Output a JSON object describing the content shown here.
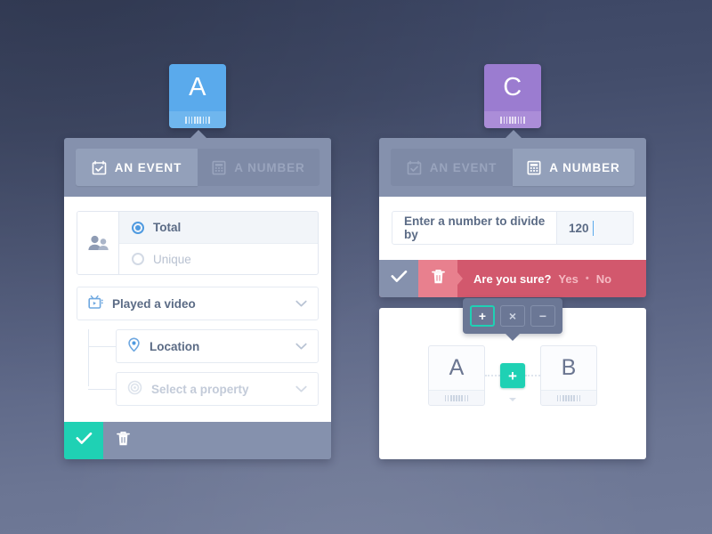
{
  "tiles": [
    {
      "letter": "A",
      "color": "#5aaaec",
      "name": "tile-a"
    },
    {
      "letter": "C",
      "color": "#9b7cd0",
      "name": "tile-c"
    }
  ],
  "left_card": {
    "tabs": [
      {
        "label": "AN EVENT",
        "icon": "calendar-check-icon",
        "active": true
      },
      {
        "label": "A NUMBER",
        "icon": "calculator-icon",
        "active": false
      }
    ],
    "audience": {
      "icon": "people-icon",
      "options": [
        {
          "label": "Total",
          "selected": true
        },
        {
          "label": "Unique",
          "selected": false
        }
      ]
    },
    "event_select": {
      "label": "Played a video",
      "icon": "video-icon",
      "chevron": "chevron-down-icon"
    },
    "filters": [
      {
        "label": "Location",
        "icon": "map-pin-icon",
        "placeholder": false
      },
      {
        "label": "Select a property",
        "icon": "target-icon",
        "placeholder": true
      }
    ],
    "footer": {
      "confirm_icon": "check-icon",
      "delete_icon": "trash-icon"
    }
  },
  "right_card": {
    "tabs": [
      {
        "label": "AN EVENT",
        "icon": "calendar-check-icon",
        "active": false
      },
      {
        "label": "A NUMBER",
        "icon": "calculator-icon",
        "active": true
      }
    ],
    "number_input": {
      "label": "Enter a number to divide by",
      "value": "120"
    },
    "footer": {
      "confirm_icon": "check-icon",
      "delete_icon": "trash-icon",
      "question": "Are you sure?",
      "yes": "Yes",
      "separator": "•",
      "no": "No"
    }
  },
  "formula_card": {
    "operands": [
      {
        "letter": "A"
      },
      {
        "letter": "B"
      }
    ],
    "operator_badge": "+",
    "operator_menu": [
      {
        "symbol": "+",
        "name": "operator-plus",
        "selected": true
      },
      {
        "symbol": "×",
        "name": "operator-multiply",
        "selected": false
      },
      {
        "symbol": "−",
        "name": "operator-minus",
        "selected": false
      }
    ]
  },
  "colors": {
    "accent_teal": "#1fd1b4",
    "danger_red": "#d2586d",
    "tab_bar": "#8591ad",
    "blue": "#5aaaec",
    "purple": "#9b7cd0"
  }
}
